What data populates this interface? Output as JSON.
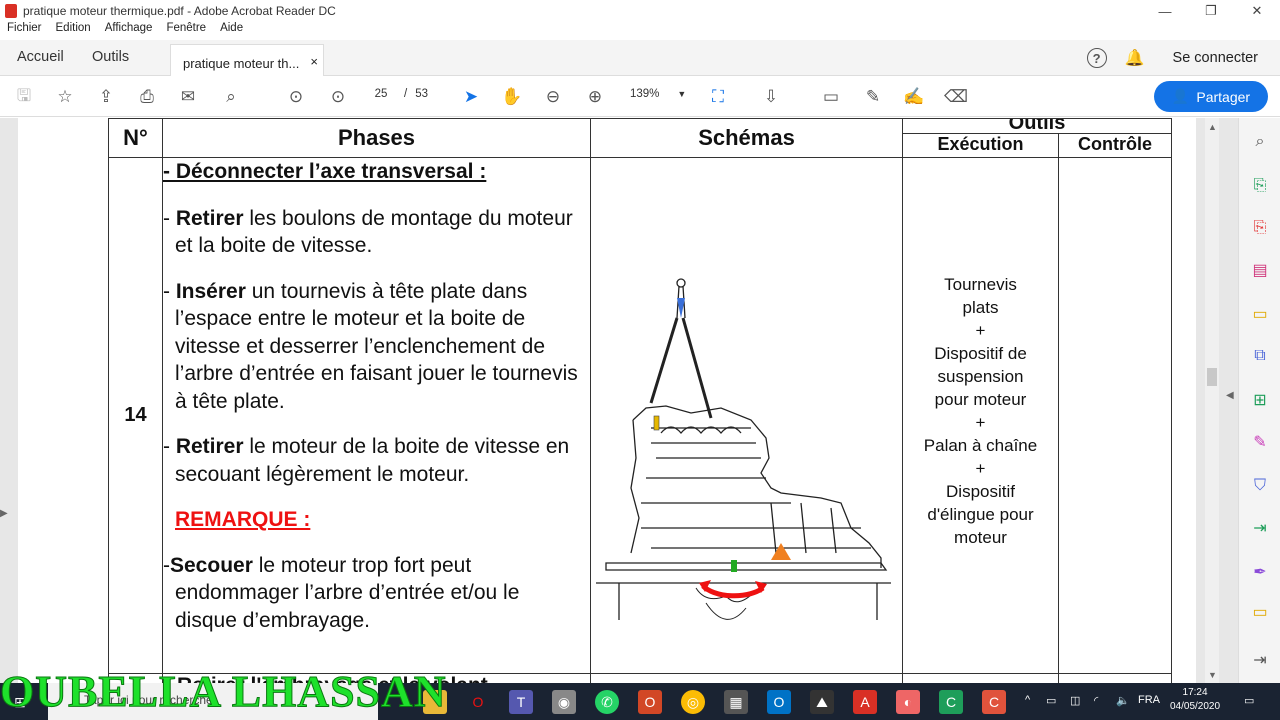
{
  "window": {
    "title": "pratique moteur thermique.pdf - Adobe Acrobat Reader DC",
    "minimize": "—",
    "restore": "❐",
    "close": "✕"
  },
  "menu": [
    "Fichier",
    "Edition",
    "Affichage",
    "Fenêtre",
    "Aide"
  ],
  "tabs": {
    "home": "Accueil",
    "tools": "Outils",
    "document": "pratique moteur th...",
    "close": "×"
  },
  "account": {
    "help": "?",
    "login": "Se connecter"
  },
  "toolbar": {
    "page_current": "25",
    "page_sep": "/",
    "page_total": "53",
    "zoom": "139%",
    "share": "Partager"
  },
  "table": {
    "header": {
      "num": "N°",
      "phases": "Phases",
      "schemas": "Schémas",
      "outils": "Outils",
      "execution": "Exécution",
      "controle": "Contrôle"
    },
    "row": {
      "num": "14",
      "heading": "- Déconnecter l’axe transversal :",
      "p1_bold": "Retirer",
      "p1_text": " les boulons de montage du moteur et la boite de vitesse.",
      "p2_bold": "Insérer",
      "p2_text": " un tournevis à tête plate dans l’espace entre le moteur et la boite de vitesse et desserrer l’enclenchement de l’arbre d’entrée en faisant jouer le tournevis à tête plate.",
      "p3_bold": "Retirer",
      "p3_text": " le moteur de la boite de vitesse en secouant légèrement le moteur.",
      "remarque": "REMARQUE :",
      "p4_bold": "Secouer",
      "p4_text": " le moteur trop fort peut endommager l’arbre d’entrée et/ou le disque d’embrayage.",
      "tools": [
        "Tournevis",
        "plats",
        "+",
        "Dispositif de",
        "suspension",
        "pour moteur",
        "+",
        "Palan à chaîne",
        "+",
        "Dispositif",
        "d'élingue pour",
        "moteur"
      ]
    },
    "next_row_partial": "Retirer l'embrayage et le volant"
  },
  "taskbar": {
    "search": "Taper ici pour rechercher",
    "lang": "FRA",
    "time": "17:24",
    "date": "04/05/2020"
  },
  "watermark": "OUBELLA LHASSAN",
  "colors": {
    "accent": "#1473e6",
    "remark": "#e11111",
    "watermark": "#1ee12b",
    "taskbar": "#1a2332"
  }
}
